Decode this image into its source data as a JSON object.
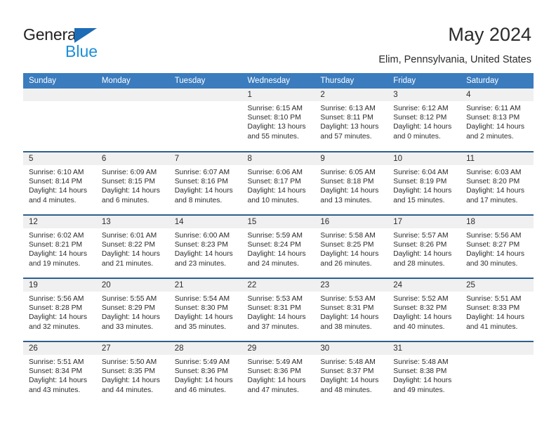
{
  "logo": {
    "primary": "General",
    "secondary": "Blue",
    "triangle_color": "#1d6cb5",
    "secondary_color": "#1d8fd8"
  },
  "header": {
    "title": "May 2024",
    "subtitle": "Elim, Pennsylvania, United States"
  },
  "theme": {
    "header_bg": "#3a7cbe",
    "week_divider": "#2e5f8f",
    "daynum_bg": "#f0f0f0",
    "text": "#2b2b2b"
  },
  "calendar": {
    "weekday_headers": [
      "Sunday",
      "Monday",
      "Tuesday",
      "Wednesday",
      "Thursday",
      "Friday",
      "Saturday"
    ],
    "labels": {
      "sunrise": "Sunrise:",
      "sunset": "Sunset:",
      "daylight": "Daylight:"
    },
    "weeks": [
      [
        {
          "day": "",
          "sunrise": "",
          "sunset": "",
          "daylight_line1": "",
          "daylight_line2": ""
        },
        {
          "day": "",
          "sunrise": "",
          "sunset": "",
          "daylight_line1": "",
          "daylight_line2": ""
        },
        {
          "day": "",
          "sunrise": "",
          "sunset": "",
          "daylight_line1": "",
          "daylight_line2": ""
        },
        {
          "day": "1",
          "sunrise": "Sunrise: 6:15 AM",
          "sunset": "Sunset: 8:10 PM",
          "daylight_line1": "Daylight: 13 hours",
          "daylight_line2": "and 55 minutes."
        },
        {
          "day": "2",
          "sunrise": "Sunrise: 6:13 AM",
          "sunset": "Sunset: 8:11 PM",
          "daylight_line1": "Daylight: 13 hours",
          "daylight_line2": "and 57 minutes."
        },
        {
          "day": "3",
          "sunrise": "Sunrise: 6:12 AM",
          "sunset": "Sunset: 8:12 PM",
          "daylight_line1": "Daylight: 14 hours",
          "daylight_line2": "and 0 minutes."
        },
        {
          "day": "4",
          "sunrise": "Sunrise: 6:11 AM",
          "sunset": "Sunset: 8:13 PM",
          "daylight_line1": "Daylight: 14 hours",
          "daylight_line2": "and 2 minutes."
        }
      ],
      [
        {
          "day": "5",
          "sunrise": "Sunrise: 6:10 AM",
          "sunset": "Sunset: 8:14 PM",
          "daylight_line1": "Daylight: 14 hours",
          "daylight_line2": "and 4 minutes."
        },
        {
          "day": "6",
          "sunrise": "Sunrise: 6:09 AM",
          "sunset": "Sunset: 8:15 PM",
          "daylight_line1": "Daylight: 14 hours",
          "daylight_line2": "and 6 minutes."
        },
        {
          "day": "7",
          "sunrise": "Sunrise: 6:07 AM",
          "sunset": "Sunset: 8:16 PM",
          "daylight_line1": "Daylight: 14 hours",
          "daylight_line2": "and 8 minutes."
        },
        {
          "day": "8",
          "sunrise": "Sunrise: 6:06 AM",
          "sunset": "Sunset: 8:17 PM",
          "daylight_line1": "Daylight: 14 hours",
          "daylight_line2": "and 10 minutes."
        },
        {
          "day": "9",
          "sunrise": "Sunrise: 6:05 AM",
          "sunset": "Sunset: 8:18 PM",
          "daylight_line1": "Daylight: 14 hours",
          "daylight_line2": "and 13 minutes."
        },
        {
          "day": "10",
          "sunrise": "Sunrise: 6:04 AM",
          "sunset": "Sunset: 8:19 PM",
          "daylight_line1": "Daylight: 14 hours",
          "daylight_line2": "and 15 minutes."
        },
        {
          "day": "11",
          "sunrise": "Sunrise: 6:03 AM",
          "sunset": "Sunset: 8:20 PM",
          "daylight_line1": "Daylight: 14 hours",
          "daylight_line2": "and 17 minutes."
        }
      ],
      [
        {
          "day": "12",
          "sunrise": "Sunrise: 6:02 AM",
          "sunset": "Sunset: 8:21 PM",
          "daylight_line1": "Daylight: 14 hours",
          "daylight_line2": "and 19 minutes."
        },
        {
          "day": "13",
          "sunrise": "Sunrise: 6:01 AM",
          "sunset": "Sunset: 8:22 PM",
          "daylight_line1": "Daylight: 14 hours",
          "daylight_line2": "and 21 minutes."
        },
        {
          "day": "14",
          "sunrise": "Sunrise: 6:00 AM",
          "sunset": "Sunset: 8:23 PM",
          "daylight_line1": "Daylight: 14 hours",
          "daylight_line2": "and 23 minutes."
        },
        {
          "day": "15",
          "sunrise": "Sunrise: 5:59 AM",
          "sunset": "Sunset: 8:24 PM",
          "daylight_line1": "Daylight: 14 hours",
          "daylight_line2": "and 24 minutes."
        },
        {
          "day": "16",
          "sunrise": "Sunrise: 5:58 AM",
          "sunset": "Sunset: 8:25 PM",
          "daylight_line1": "Daylight: 14 hours",
          "daylight_line2": "and 26 minutes."
        },
        {
          "day": "17",
          "sunrise": "Sunrise: 5:57 AM",
          "sunset": "Sunset: 8:26 PM",
          "daylight_line1": "Daylight: 14 hours",
          "daylight_line2": "and 28 minutes."
        },
        {
          "day": "18",
          "sunrise": "Sunrise: 5:56 AM",
          "sunset": "Sunset: 8:27 PM",
          "daylight_line1": "Daylight: 14 hours",
          "daylight_line2": "and 30 minutes."
        }
      ],
      [
        {
          "day": "19",
          "sunrise": "Sunrise: 5:56 AM",
          "sunset": "Sunset: 8:28 PM",
          "daylight_line1": "Daylight: 14 hours",
          "daylight_line2": "and 32 minutes."
        },
        {
          "day": "20",
          "sunrise": "Sunrise: 5:55 AM",
          "sunset": "Sunset: 8:29 PM",
          "daylight_line1": "Daylight: 14 hours",
          "daylight_line2": "and 33 minutes."
        },
        {
          "day": "21",
          "sunrise": "Sunrise: 5:54 AM",
          "sunset": "Sunset: 8:30 PM",
          "daylight_line1": "Daylight: 14 hours",
          "daylight_line2": "and 35 minutes."
        },
        {
          "day": "22",
          "sunrise": "Sunrise: 5:53 AM",
          "sunset": "Sunset: 8:31 PM",
          "daylight_line1": "Daylight: 14 hours",
          "daylight_line2": "and 37 minutes."
        },
        {
          "day": "23",
          "sunrise": "Sunrise: 5:53 AM",
          "sunset": "Sunset: 8:31 PM",
          "daylight_line1": "Daylight: 14 hours",
          "daylight_line2": "and 38 minutes."
        },
        {
          "day": "24",
          "sunrise": "Sunrise: 5:52 AM",
          "sunset": "Sunset: 8:32 PM",
          "daylight_line1": "Daylight: 14 hours",
          "daylight_line2": "and 40 minutes."
        },
        {
          "day": "25",
          "sunrise": "Sunrise: 5:51 AM",
          "sunset": "Sunset: 8:33 PM",
          "daylight_line1": "Daylight: 14 hours",
          "daylight_line2": "and 41 minutes."
        }
      ],
      [
        {
          "day": "26",
          "sunrise": "Sunrise: 5:51 AM",
          "sunset": "Sunset: 8:34 PM",
          "daylight_line1": "Daylight: 14 hours",
          "daylight_line2": "and 43 minutes."
        },
        {
          "day": "27",
          "sunrise": "Sunrise: 5:50 AM",
          "sunset": "Sunset: 8:35 PM",
          "daylight_line1": "Daylight: 14 hours",
          "daylight_line2": "and 44 minutes."
        },
        {
          "day": "28",
          "sunrise": "Sunrise: 5:49 AM",
          "sunset": "Sunset: 8:36 PM",
          "daylight_line1": "Daylight: 14 hours",
          "daylight_line2": "and 46 minutes."
        },
        {
          "day": "29",
          "sunrise": "Sunrise: 5:49 AM",
          "sunset": "Sunset: 8:36 PM",
          "daylight_line1": "Daylight: 14 hours",
          "daylight_line2": "and 47 minutes."
        },
        {
          "day": "30",
          "sunrise": "Sunrise: 5:48 AM",
          "sunset": "Sunset: 8:37 PM",
          "daylight_line1": "Daylight: 14 hours",
          "daylight_line2": "and 48 minutes."
        },
        {
          "day": "31",
          "sunrise": "Sunrise: 5:48 AM",
          "sunset": "Sunset: 8:38 PM",
          "daylight_line1": "Daylight: 14 hours",
          "daylight_line2": "and 49 minutes."
        },
        {
          "day": "",
          "sunrise": "",
          "sunset": "",
          "daylight_line1": "",
          "daylight_line2": ""
        }
      ]
    ]
  }
}
